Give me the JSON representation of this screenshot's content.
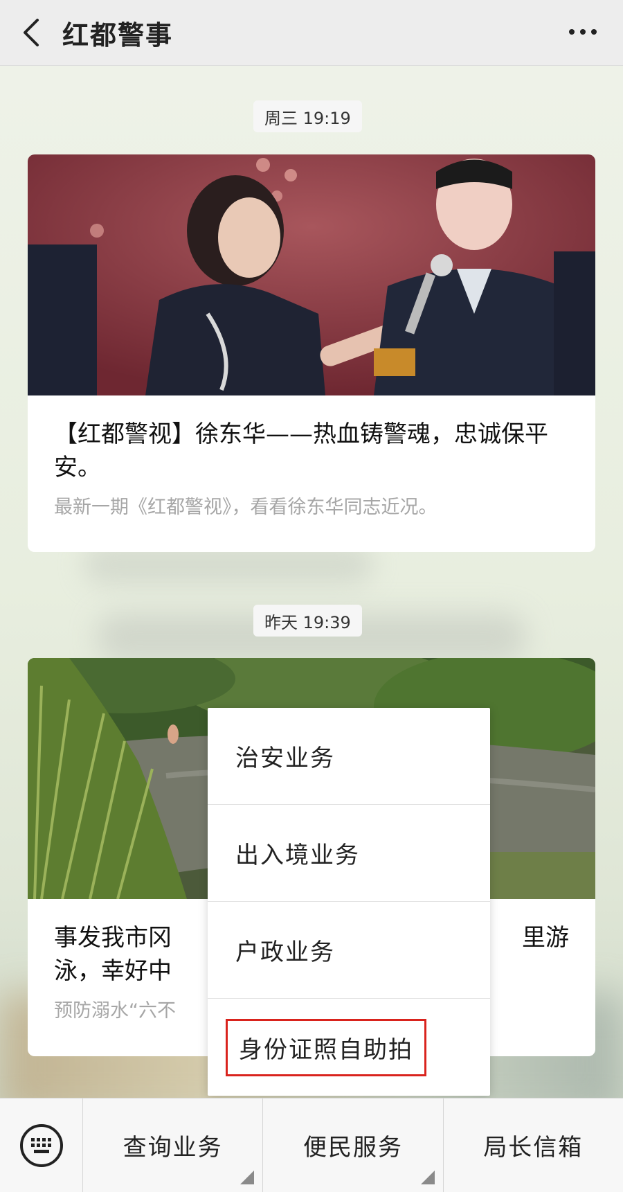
{
  "header": {
    "title": "红都警事"
  },
  "messages": [
    {
      "time": "周三 19:19",
      "title": "【红都警视】徐东华——热血铸警魂，忠诚保平安。",
      "desc": "最新一期《红都警视》，看看徐东华同志近况。"
    },
    {
      "time": "昨天 19:39",
      "title": "事发我市冈",
      "title_right": "里游",
      "title2": "泳，幸好中",
      "desc": "预防溺水“六不"
    }
  ],
  "popup_menu": {
    "items": [
      "治安业务",
      "出入境业务",
      "户政业务",
      "身份证照自助拍"
    ]
  },
  "bottom_bar": {
    "tabs": [
      "查询业务",
      "便民服务",
      "局长信箱"
    ]
  }
}
